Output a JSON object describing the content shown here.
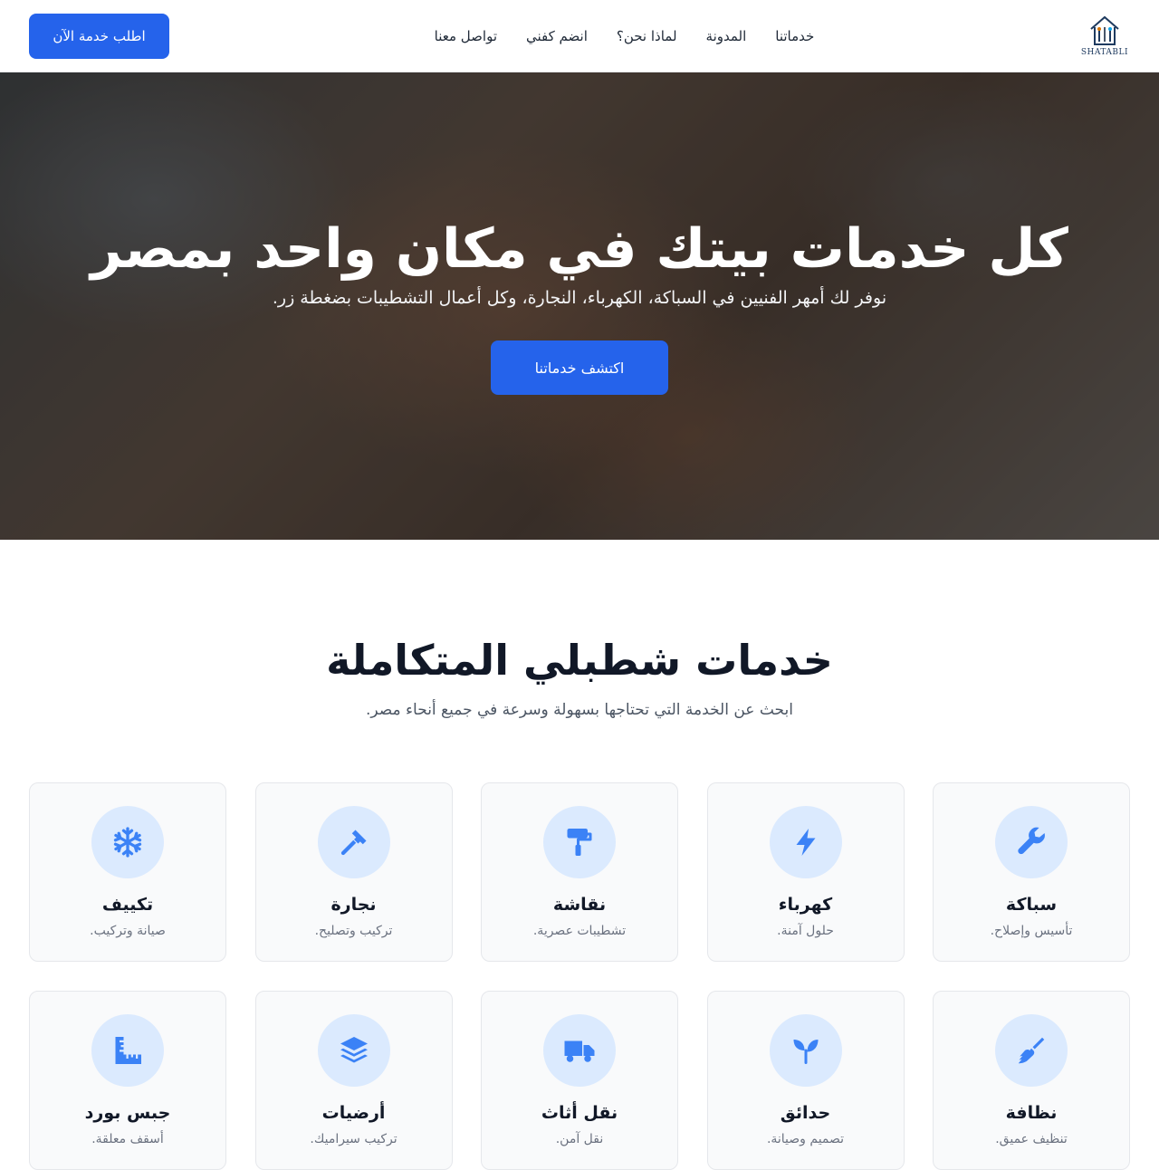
{
  "header": {
    "cta_label": "اطلب خدمة الآن",
    "nav": [
      "خدماتنا",
      "المدونة",
      "لماذا نحن؟",
      "انضم كفني",
      "تواصل معنا"
    ],
    "logo_text": "SHATABLI"
  },
  "hero": {
    "title": "كل خدمات بيتك في مكان واحد بمصر",
    "subtitle": "نوفر لك أمهر الفنيين في السباكة، الكهرباء، النجارة، وكل أعمال التشطيبات بضغطة زر.",
    "button_label": "اكتشف خدماتنا"
  },
  "services": {
    "title": "خدمات شطبلي المتكاملة",
    "subtitle": "ابحث عن الخدمة التي تحتاجها بسهولة وسرعة في جميع أنحاء مصر.",
    "items": [
      {
        "title": "سباكة",
        "desc": "تأسيس وإصلاح.",
        "icon": "wrench-icon"
      },
      {
        "title": "كهرباء",
        "desc": "حلول آمنة.",
        "icon": "bolt-icon"
      },
      {
        "title": "نقاشة",
        "desc": "تشطيبات عصرية.",
        "icon": "paint-roller-icon"
      },
      {
        "title": "نجارة",
        "desc": "تركيب وتصليح.",
        "icon": "hammer-icon"
      },
      {
        "title": "تكييف",
        "desc": "صيانة وتركيب.",
        "icon": "snowflake-icon"
      },
      {
        "title": "نظافة",
        "desc": "تنظيف عميق.",
        "icon": "broom-icon"
      },
      {
        "title": "حدائق",
        "desc": "تصميم وصيانة.",
        "icon": "seedling-icon"
      },
      {
        "title": "نقل أثاث",
        "desc": "نقل آمن.",
        "icon": "truck-icon"
      },
      {
        "title": "أرضيات",
        "desc": "تركيب سيراميك.",
        "icon": "layers-icon"
      },
      {
        "title": "جبس بورد",
        "desc": "أسقف معلقة.",
        "icon": "ruler-icon"
      }
    ]
  },
  "colors": {
    "primary": "#2563eb",
    "icon_bg": "#dbeafe",
    "icon_fg": "#3b82f6"
  }
}
